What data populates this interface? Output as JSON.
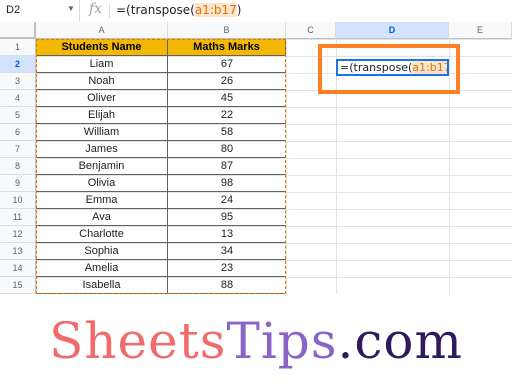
{
  "formula_bar": {
    "cell_ref": "D2",
    "fx_label": "fx",
    "formula_prefix": "=(transpose(",
    "formula_ref": "a1:b17",
    "formula_suffix": ")"
  },
  "columns": [
    "A",
    "B",
    "C",
    "D",
    "E"
  ],
  "rows": [
    "1",
    "2",
    "3",
    "4",
    "5",
    "6",
    "7",
    "8",
    "9",
    "10",
    "11",
    "12",
    "13",
    "14",
    "15"
  ],
  "table": {
    "headers": [
      "Students Name",
      "Maths Marks"
    ],
    "rows": [
      [
        "Liam",
        "67"
      ],
      [
        "Noah",
        "26"
      ],
      [
        "Oliver",
        "45"
      ],
      [
        "Elijah",
        "22"
      ],
      [
        "William",
        "58"
      ],
      [
        "James",
        "80"
      ],
      [
        "Benjamin",
        "87"
      ],
      [
        "Olivia",
        "98"
      ],
      [
        "Emma",
        "24"
      ],
      [
        "Ava",
        "95"
      ],
      [
        "Charlotte",
        "13"
      ],
      [
        "Sophia",
        "34"
      ],
      [
        "Amelia",
        "23"
      ],
      [
        "Isabella",
        "88"
      ]
    ]
  },
  "active_cell": {
    "formula_prefix": "=(transpose(",
    "formula_ref": "a1:b17",
    "formula_suffix": ")"
  },
  "brand": {
    "part1": "Sheets",
    "part2": "Tips",
    "part3": ".com",
    "colors": {
      "part1": "#f26b6b",
      "part2": "#8a63c7",
      "part3": "#2e1a5c"
    }
  },
  "colors": {
    "header_fill": "#f5b800",
    "highlight_border": "#ff7f27",
    "active_cell_border": "#1a73e8",
    "marquee": "#e37400"
  }
}
